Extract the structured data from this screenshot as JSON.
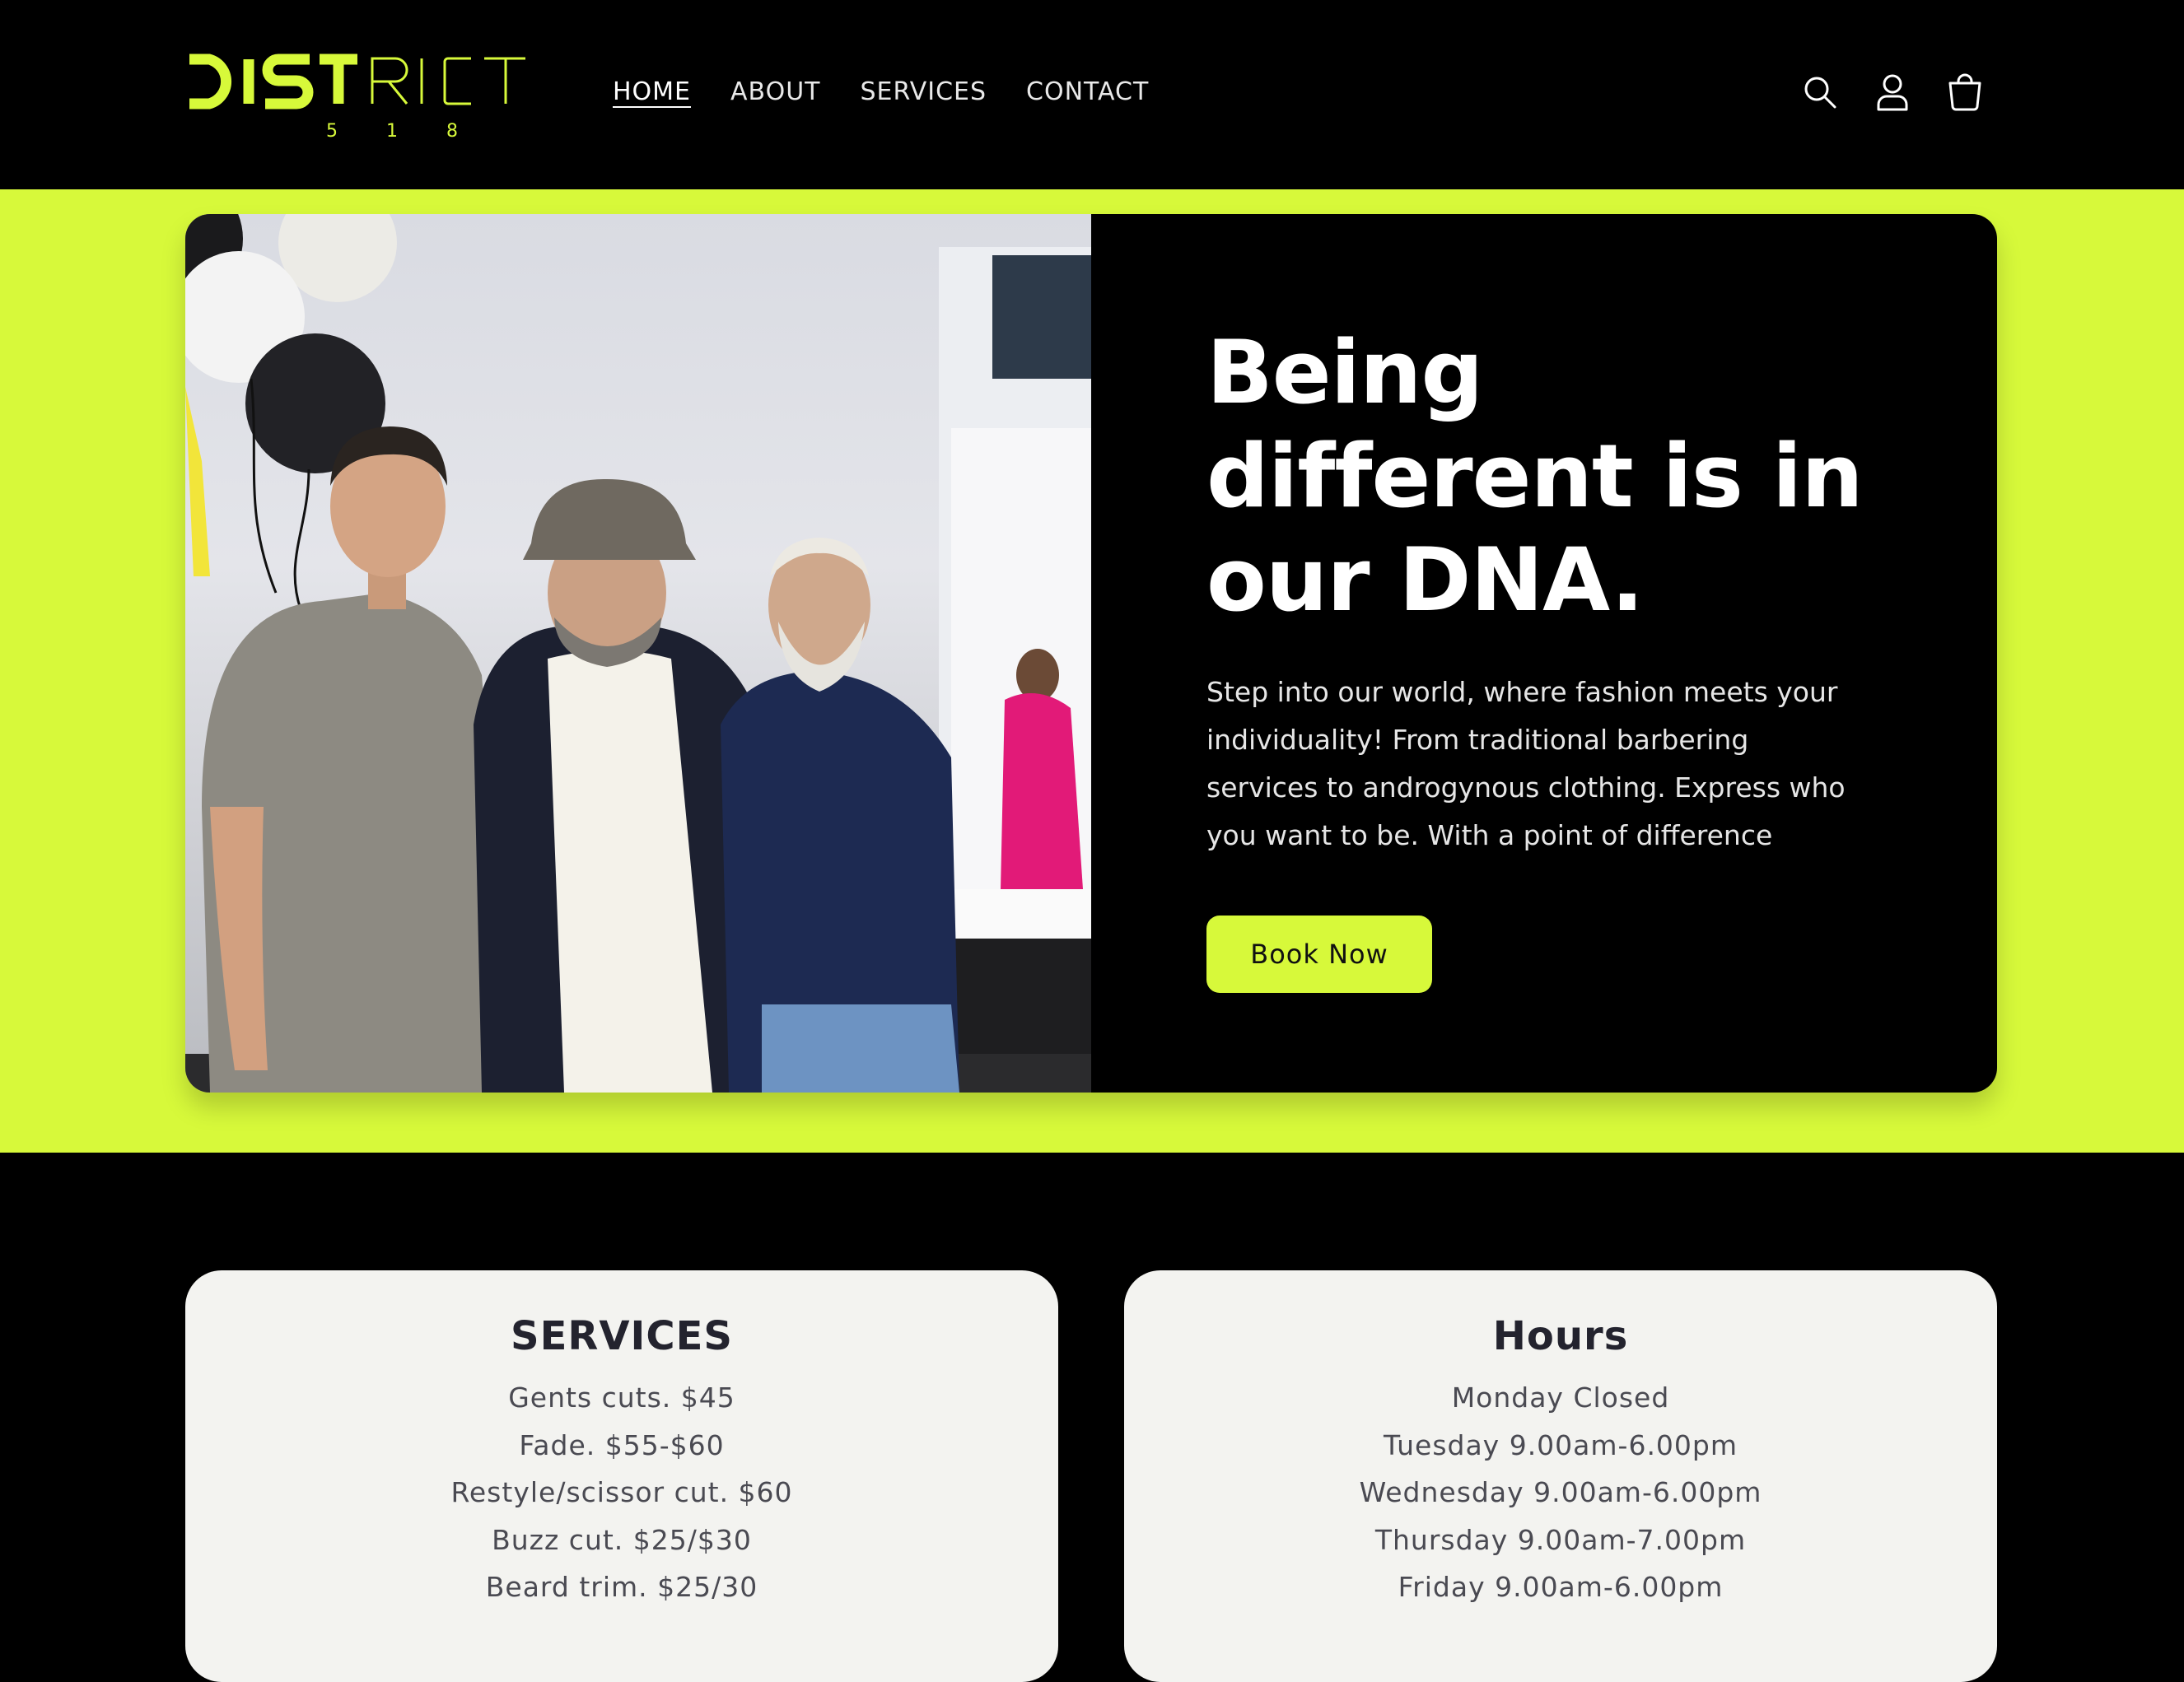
{
  "header": {
    "logo_text": "DISTRICT",
    "logo_sub": "5 1 8",
    "nav": [
      {
        "label": "HOME",
        "active": true
      },
      {
        "label": "ABOUT",
        "active": false
      },
      {
        "label": "SERVICES",
        "active": false
      },
      {
        "label": "CONTACT",
        "active": false
      }
    ],
    "icons": [
      "search-icon",
      "account-icon",
      "cart-icon"
    ]
  },
  "hero": {
    "title": "Being different is in our DNA.",
    "body": "Step into our world, where fashion meets your individuality! From traditional barbering services to androgynous clothing. Express who you want to be. With a point of difference",
    "button": "Book Now"
  },
  "services": {
    "heading": "SERVICES",
    "items": [
      "Gents cuts. $45",
      "Fade. $55-$60",
      "Restyle/scissor cut. $60",
      "Buzz cut. $25/$30",
      "Beard trim. $25/30"
    ]
  },
  "hours": {
    "heading": "Hours",
    "items": [
      "Monday Closed",
      "Tuesday 9.00am-6.00pm",
      "Wednesday 9.00am-6.00pm",
      "Thursday 9.00am-7.00pm",
      "Friday 9.00am-6.00pm"
    ]
  },
  "colors": {
    "accent": "#d7f93a",
    "background": "#000000",
    "card": "#f3f3f0"
  }
}
